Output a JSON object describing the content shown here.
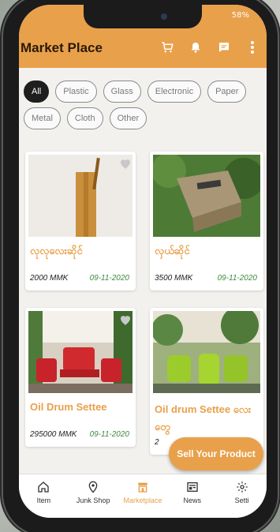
{
  "status": {
    "time": "",
    "battery": "58%"
  },
  "appbar": {
    "title": "Market Place",
    "icons": [
      "cart-icon",
      "bell-icon",
      "chat-icon",
      "more-vert-icon"
    ]
  },
  "chips": [
    "All",
    "Plastic",
    "Glass",
    "Electronic",
    "Paper",
    "Metal",
    "Cloth",
    "Other"
  ],
  "products": [
    {
      "name": "လုလုလေးဆိုင်",
      "price": "2000 MMK",
      "date": "09-11-2020"
    },
    {
      "name": "လှယ်ဆိုင်",
      "price": "3500 MMK",
      "date": "09-11-2020"
    },
    {
      "name": "Oil Drum Settee",
      "price": "295000 MMK",
      "date": "09-11-2020"
    },
    {
      "name": "Oil drum Settee လေးတွေ",
      "price": "2",
      "date": ""
    }
  ],
  "fab": {
    "label": "Sell Your Product"
  },
  "nav": [
    {
      "label": "Item",
      "icon": "home-icon"
    },
    {
      "label": "Junk Shop",
      "icon": "location-pin-icon"
    },
    {
      "label": "Marketplace",
      "icon": "shop-icon"
    },
    {
      "label": "News",
      "icon": "news-icon"
    },
    {
      "label": "Setti",
      "icon": "gear-icon"
    }
  ],
  "colors": {
    "accent": "#e9a04b",
    "date_green": "#3d8a3d"
  }
}
